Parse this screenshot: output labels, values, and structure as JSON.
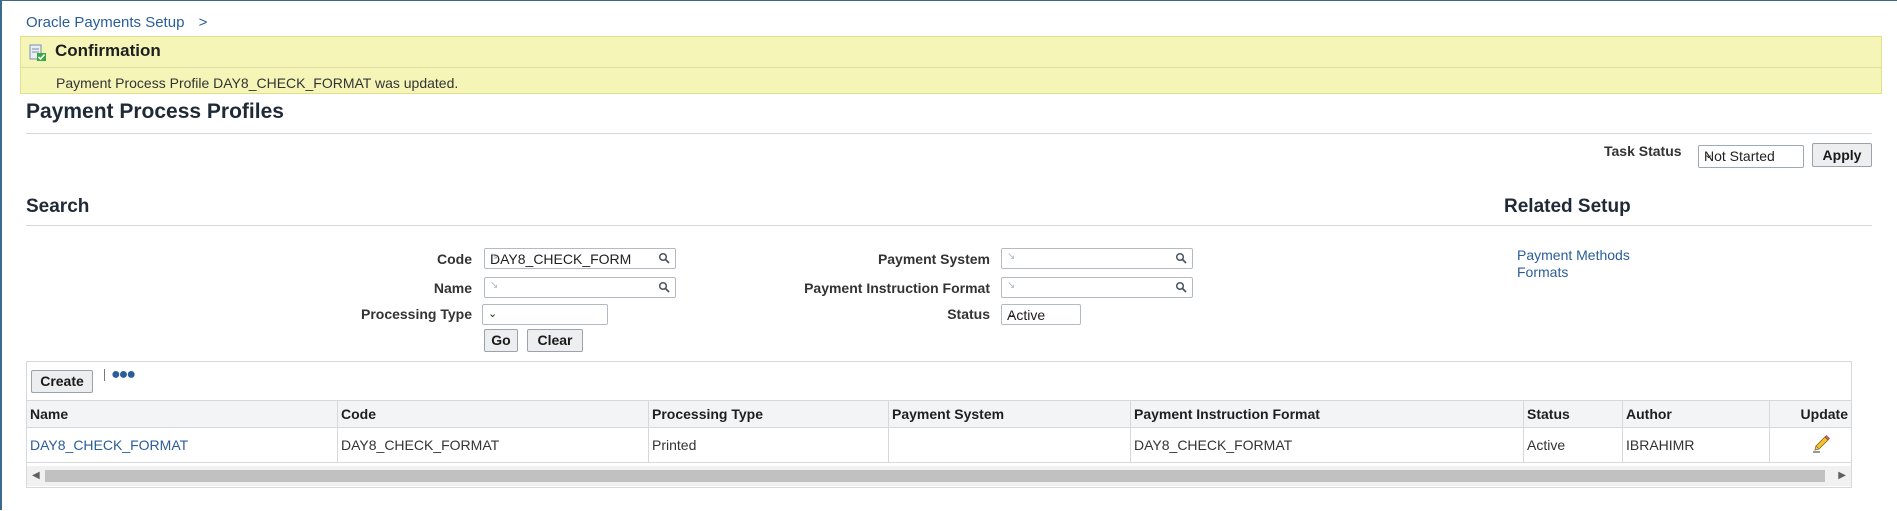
{
  "breadcrumb": {
    "link": "Oracle Payments Setup",
    "sep": ">"
  },
  "confirmation": {
    "title": "Confirmation",
    "message": "Payment Process Profile DAY8_CHECK_FORMAT was updated."
  },
  "page_title": "Payment Process Profiles",
  "task": {
    "label": "Task Status",
    "value": "Not Started",
    "apply_label": "Apply"
  },
  "search": {
    "title": "Search",
    "code_label": "Code",
    "code_value": "DAY8_CHECK_FORM",
    "name_label": "Name",
    "name_value": "",
    "processing_type_label": "Processing Type",
    "processing_type_value": "",
    "payment_system_label": "Payment System",
    "payment_system_value": "",
    "pif_label": "Payment Instruction Format",
    "pif_value": "",
    "status_label": "Status",
    "status_value": "Active",
    "go_label": "Go",
    "clear_label": "Clear"
  },
  "related": {
    "title": "Related Setup",
    "links": [
      "Payment Methods",
      "Formats"
    ]
  },
  "table": {
    "create_label": "Create",
    "more_icon": "ellipsis-icon",
    "columns": [
      "Name",
      "Code",
      "Processing Type",
      "Payment System",
      "Payment Instruction Format",
      "Status",
      "Author",
      "Update"
    ],
    "rows": [
      {
        "name": "DAY8_CHECK_FORMAT",
        "code": "DAY8_CHECK_FORMAT",
        "processing_type": "Printed",
        "payment_system": "",
        "pif": "DAY8_CHECK_FORMAT",
        "status": "Active",
        "author": "IBRAHIMR",
        "update_icon": "pencil-icon"
      }
    ]
  },
  "colors": {
    "link": "#2a5d9a",
    "confirm_bg": "#f6f5b8",
    "header_bg": "#f2f4f6"
  }
}
